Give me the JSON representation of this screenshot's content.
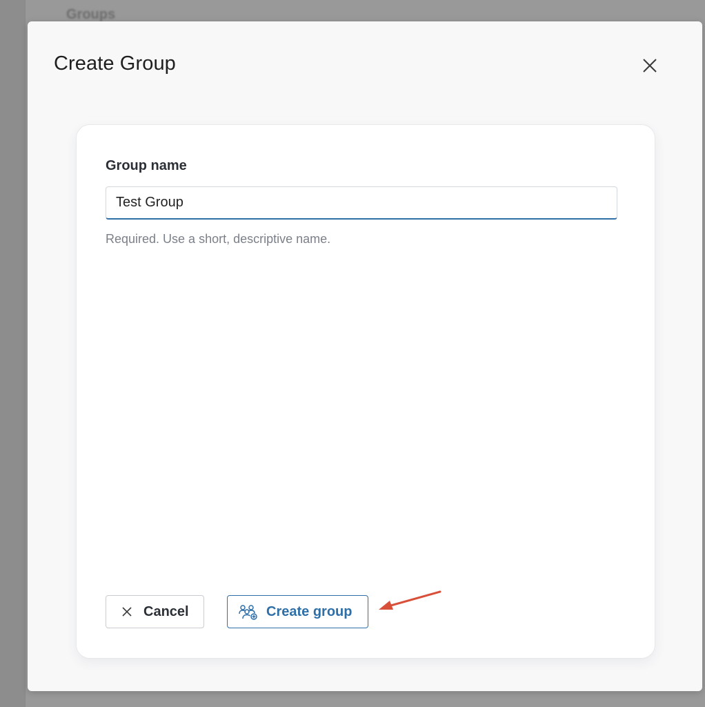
{
  "background": {
    "heading": "Groups"
  },
  "dialog": {
    "title": "Create Group",
    "close_icon": "close-icon"
  },
  "form": {
    "label": "Group name",
    "input_value": "Test Group",
    "helper_text": "Required. Use a short, descriptive name."
  },
  "actions": {
    "cancel_label": "Cancel",
    "cancel_icon": "close-icon",
    "create_label": "Create group",
    "create_icon": "group-add-icon"
  },
  "colors": {
    "accent": "#2f6fa8",
    "annotation": "#d9503a",
    "title_text": "#1f1f1f",
    "helper_text": "#7b7f88"
  }
}
